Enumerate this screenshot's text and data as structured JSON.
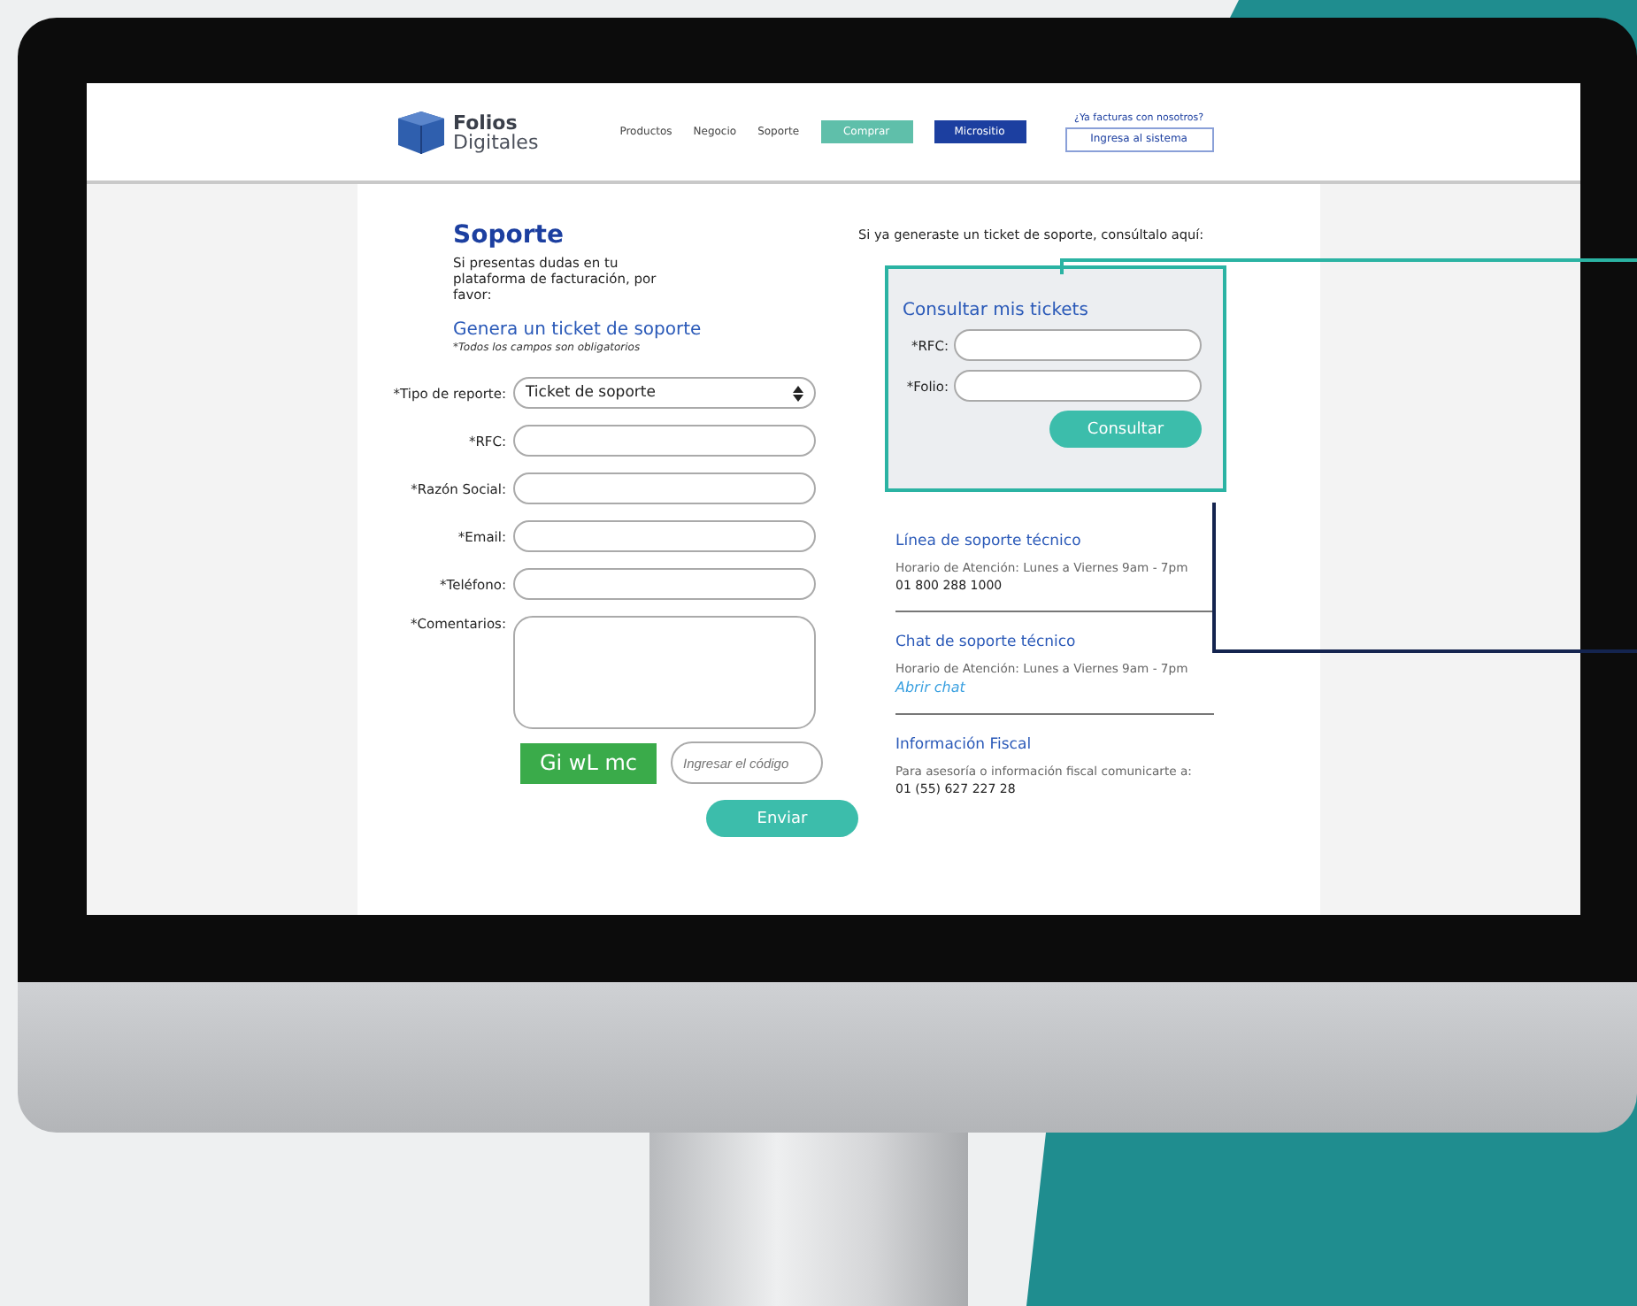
{
  "header": {
    "logo": {
      "line1": "Folios",
      "line2": "Digitales"
    },
    "nav": [
      {
        "label": "Productos",
        "kind": "link"
      },
      {
        "label": "Negocio",
        "kind": "link"
      },
      {
        "label": "Soporte",
        "kind": "link"
      },
      {
        "label": "Comprar",
        "kind": "teal"
      },
      {
        "label": "Micrositio",
        "kind": "navy"
      }
    ],
    "login": {
      "prompt": "¿Ya facturas con nosotros?",
      "button": "Ingresa al sistema"
    }
  },
  "form": {
    "title": "Soporte",
    "intro": "Si presentas dudas en tu plataforma de facturación, por favor:",
    "subtitle": "Genera un ticket de soporte",
    "note": "*Todos los campos son obligatorios",
    "fields": [
      {
        "label": "*Tipo de reporte:",
        "kind": "select",
        "value": "Ticket de soporte"
      },
      {
        "label": "*RFC:",
        "kind": "text"
      },
      {
        "label": "*Razón Social:",
        "kind": "text"
      },
      {
        "label": "*Email:",
        "kind": "text"
      },
      {
        "label": "*Teléfono:",
        "kind": "text"
      },
      {
        "label": "*Comentarios:",
        "kind": "textarea"
      }
    ],
    "captcha": "Gi wL mc",
    "code": {
      "placeholder": "Ingresar el código"
    },
    "submit": "Enviar"
  },
  "lookup": {
    "intro": "Si ya generaste un ticket de soporte, consúltalo aquí:",
    "title": "Consultar mis tickets",
    "fields": [
      {
        "label": "*RFC:"
      },
      {
        "label": "*Folio:"
      }
    ],
    "button": "Consultar"
  },
  "contacts": [
    {
      "title": "Línea de soporte técnico",
      "hours": "Horario de Atención: Lunes a Viernes 9am - 7pm",
      "detail": "01 800 288 1000",
      "kind": "phone"
    },
    {
      "title": "Chat de soporte técnico",
      "hours": "Horario de Atención: Lunes a Viernes 9am - 7pm",
      "detail": "Abrir chat",
      "kind": "link"
    },
    {
      "title": "Información Fiscal",
      "hours": "Para asesoría o información fiscal comunicarte a:",
      "detail": "01 (55) 627 227 28",
      "kind": "phone"
    }
  ]
}
